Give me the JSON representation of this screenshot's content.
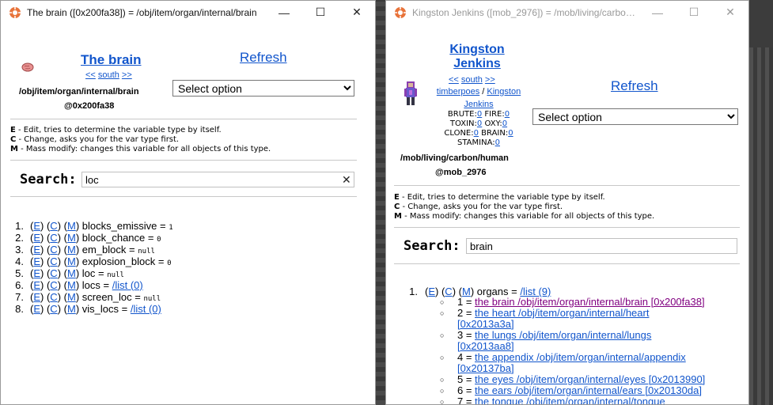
{
  "w1": {
    "title": "The brain ([0x200fa38]) = /obj/item/organ/internal/brain",
    "heading": "The brain",
    "nav_prev": "<<",
    "nav_dir": "south",
    "nav_next": ">>",
    "path": "/obj/item/organ/internal/brain",
    "ref": "@0x200fa38",
    "refresh": "Refresh",
    "select": "Select option",
    "help": [
      {
        "key": "E",
        "text": " - Edit, tries to determine the variable type by itself."
      },
      {
        "key": "C",
        "text": " - Change, asks you for the var type first."
      },
      {
        "key": "M",
        "text": " - Mass modify: changes this variable for all objects of this type."
      }
    ],
    "search_label": "Search:",
    "search_value": "loc",
    "clear": "✕",
    "vars": [
      {
        "num": "1.",
        "name": "blocks_emissive",
        "eq": " = ",
        "val": "1",
        "link": ""
      },
      {
        "num": "2.",
        "name": "block_chance",
        "eq": " = ",
        "val": "0",
        "link": ""
      },
      {
        "num": "3.",
        "name": "em_block",
        "eq": " = ",
        "val": "null",
        "link": ""
      },
      {
        "num": "4.",
        "name": "explosion_block",
        "eq": " = ",
        "val": "0",
        "link": ""
      },
      {
        "num": "5.",
        "name": "loc",
        "eq": " = ",
        "val": "null",
        "link": ""
      },
      {
        "num": "6.",
        "name": "locs",
        "eq": " = ",
        "val": "",
        "link": "/list (0)"
      },
      {
        "num": "7.",
        "name": "screen_loc",
        "eq": " = ",
        "val": "null",
        "link": ""
      },
      {
        "num": "8.",
        "name": "vis_locs",
        "eq": " = ",
        "val": "",
        "link": "/list (0)"
      }
    ]
  },
  "w2": {
    "title": "Kingston Jenkins ([mob_2976]) = /mob/living/carbon/h...",
    "heading_line1": "Kingston",
    "heading_line2": "Jenkins",
    "nav_prev": "<<",
    "nav_dir": "south",
    "nav_next": ">>",
    "ckey": "timberpoes",
    "slash": " / ",
    "name_a": "Kingston",
    "name_b": "Jenkins",
    "stats": {
      "brute_l": "BRUTE:",
      "brute": "0",
      "fire_l": " FIRE:",
      "fire": "0",
      "toxin_l": "TOXIN:",
      "toxin": "0",
      "oxy_l": " OXY:",
      "oxy": "0",
      "clone_l": "CLONE:",
      "clone": "0",
      "brain_l": " BRAIN:",
      "brain": "0",
      "stamina_l": "STAMINA:",
      "stamina": "0"
    },
    "path": "/mob/living/carbon/human",
    "ref": "@mob_2976",
    "refresh": "Refresh",
    "select": "Select option",
    "help": [
      {
        "key": "E",
        "text": " - Edit, tries to determine the variable type by itself."
      },
      {
        "key": "C",
        "text": " - Change, asks you for the var type first."
      },
      {
        "key": "M",
        "text": " - Mass modify: changes this variable for all objects of this type."
      }
    ],
    "search_label": "Search:",
    "search_value": "brain",
    "var": {
      "num": "1.",
      "name": "organs",
      "eq": " = ",
      "link": "/list (9)"
    },
    "organs": [
      {
        "idx": "1 = ",
        "l1": "the brain /obj/item/organ/internal/brain [0x200fa38]",
        "l2": "",
        "visited": true
      },
      {
        "idx": "2 = ",
        "l1": "the heart /obj/item/organ/internal/heart",
        "l2": "[0x2013a3a]",
        "visited": false
      },
      {
        "idx": "3 = ",
        "l1": "the lungs /obj/item/organ/internal/lungs",
        "l2": "[0x2013aa8]",
        "visited": false
      },
      {
        "idx": "4 = ",
        "l1": "the appendix /obj/item/organ/internal/appendix",
        "l2": "[0x20137ba]",
        "visited": false
      },
      {
        "idx": "5 = ",
        "l1": "the eyes /obj/item/organ/internal/eyes [0x2013990]",
        "l2": "",
        "visited": false
      },
      {
        "idx": "6 = ",
        "l1": "the ears /obj/item/organ/internal/ears [0x20130da]",
        "l2": "",
        "visited": false
      },
      {
        "idx": "7 = ",
        "l1": "the tongue /obj/item/organ/internal/tongue",
        "l2": "",
        "visited": false
      }
    ]
  },
  "edit_e": "E",
  "edit_c": "C",
  "edit_m": "M",
  "colors": {
    "link": "#1155cc",
    "visited": "#800080"
  }
}
